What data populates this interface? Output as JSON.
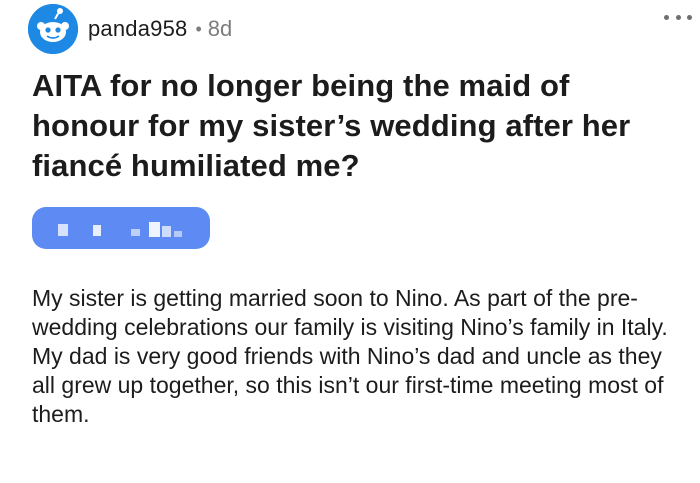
{
  "post": {
    "author": {
      "username": "panda958",
      "separator": "•",
      "age": "8d",
      "avatar_icon": "reddit-snoo-avatar-icon",
      "avatar_color": "#1e88e5"
    },
    "more_icon": "more-horizontal-icon",
    "title": "AITA for no longer being the maid of honour for my sister’s wedding after her fiancé humiliated me?",
    "flair": {
      "text": "",
      "color": "#5d8af3",
      "obscured": true
    },
    "body": "My sister is getting married soon to Nino. As part of the pre-wedding celebrations our family is visiting Nino’s family in Italy. My dad is very good friends with Nino’s dad and uncle as they all grew up together, so this isn’t our first-time meeting most of them."
  }
}
